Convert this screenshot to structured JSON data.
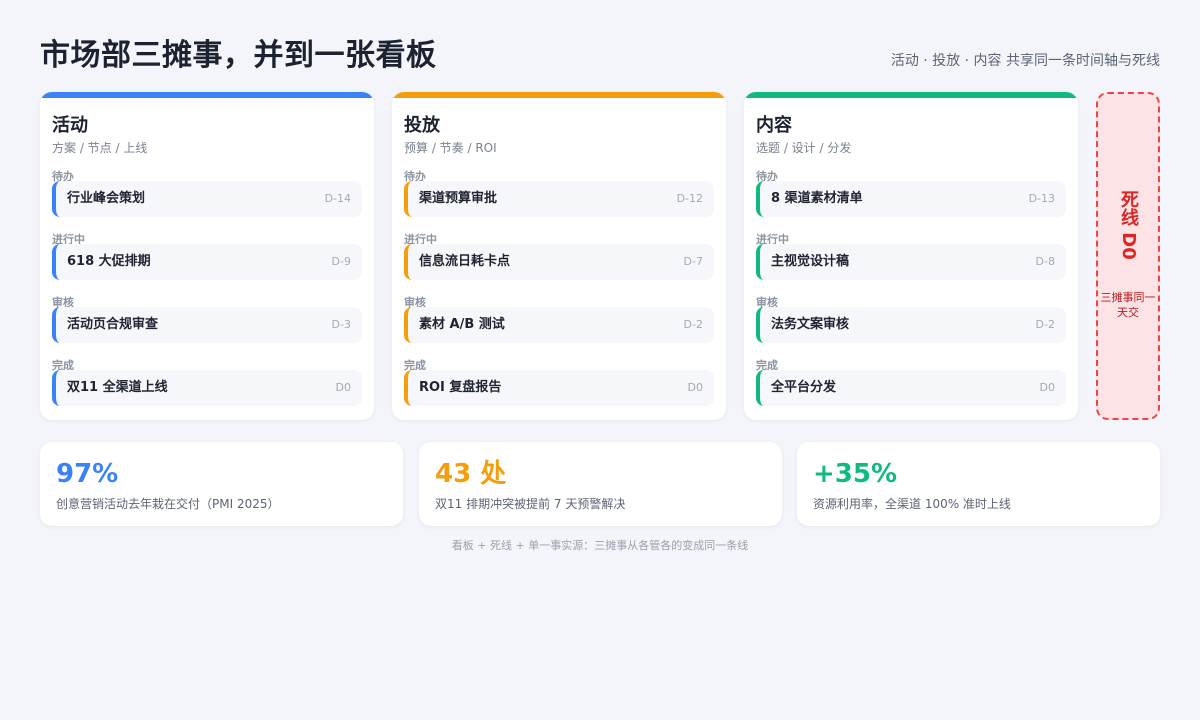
{
  "header": {
    "title": "市场部三摊事，并到一张看板",
    "subtitle": "活动 · 投放 · 内容 共享同一条时间轴与死线"
  },
  "boards": [
    {
      "title": "活动",
      "subtitle": "方案 / 节点 / 上线",
      "accent": "#3b82f6",
      "lanes": [
        {
          "label": "待办",
          "card": "行业峰会策划",
          "day": "D-14"
        },
        {
          "label": "进行中",
          "card": "618 大促排期",
          "day": "D-9"
        },
        {
          "label": "审核",
          "card": "活动页合规审查",
          "day": "D-3"
        },
        {
          "label": "完成",
          "card": "双11 全渠道上线",
          "day": "D0"
        }
      ]
    },
    {
      "title": "投放",
      "subtitle": "预算 / 节奏 / ROI",
      "accent": "#f59e0b",
      "lanes": [
        {
          "label": "待办",
          "card": "渠道预算审批",
          "day": "D-12"
        },
        {
          "label": "进行中",
          "card": "信息流日耗卡点",
          "day": "D-7"
        },
        {
          "label": "审核",
          "card": "素材 A/B 测试",
          "day": "D-2"
        },
        {
          "label": "完成",
          "card": "ROI 复盘报告",
          "day": "D0"
        }
      ]
    },
    {
      "title": "内容",
      "subtitle": "选题 / 设计 / 分发",
      "accent": "#10b981",
      "lanes": [
        {
          "label": "待办",
          "card": "8 渠道素材清单",
          "day": "D-13"
        },
        {
          "label": "进行中",
          "card": "主视觉设计稿",
          "day": "D-8"
        },
        {
          "label": "审核",
          "card": "法务文案审核",
          "day": "D-2"
        },
        {
          "label": "完成",
          "card": "全平台分发",
          "day": "D0"
        }
      ]
    }
  ],
  "deadline": {
    "label": "死线 D0",
    "note": "三摊事同一天交",
    "color": "#dc2626"
  },
  "stats": [
    {
      "value": "97%",
      "desc": "创意营销活动去年栽在交付（PMI 2025）",
      "color": "#3b82f6"
    },
    {
      "value": "43 处",
      "desc": "双11 排期冲突被提前 7 天预警解决",
      "color": "#f59e0b"
    },
    {
      "value": "+35%",
      "desc": "资源利用率，全渠道 100% 准时上线",
      "color": "#10b981"
    }
  ],
  "footer": "看板 + 死线 + 单一事实源：三摊事从各管各的变成同一条线"
}
